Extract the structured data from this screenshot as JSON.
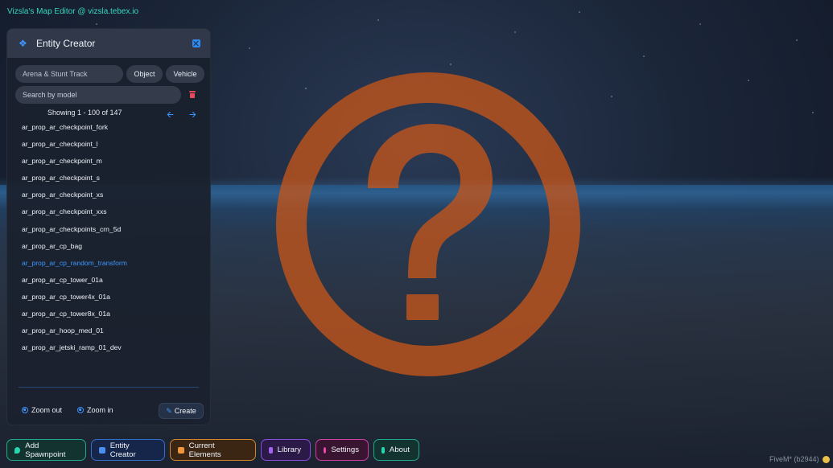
{
  "app": {
    "title": "Vizsla's Map Editor @ vizsla.tebex.io",
    "accent": "#3d96ff"
  },
  "panel": {
    "title": "Entity Creator",
    "header_icon": "dropbox-icon",
    "category_select": {
      "value": "Arena & Stunt Track"
    },
    "type_chips": [
      "Object",
      "Vehicle"
    ],
    "search": {
      "placeholder": "Search by model"
    },
    "paging": {
      "text": "Showing 1 - 100 of 147"
    },
    "items": [
      "ar_prop_ar_checkpoint_fork",
      "ar_prop_ar_checkpoint_l",
      "ar_prop_ar_checkpoint_m",
      "ar_prop_ar_checkpoint_s",
      "ar_prop_ar_checkpoint_xs",
      "ar_prop_ar_checkpoint_xxs",
      "ar_prop_ar_checkpoints_crn_5d",
      "ar_prop_ar_cp_bag",
      "ar_prop_ar_cp_random_transform",
      "ar_prop_ar_cp_tower_01a",
      "ar_prop_ar_cp_tower4x_01a",
      "ar_prop_ar_cp_tower8x_01a",
      "ar_prop_ar_hoop_med_01",
      "ar_prop_ar_jetski_ramp_01_dev"
    ],
    "selected_item": "ar_prop_ar_cp_random_transform",
    "zoom_out_label": "Zoom out",
    "zoom_in_label": "Zoom in",
    "create_label": "Create"
  },
  "nav": [
    {
      "label": "Add Spawnpoint",
      "icon": "pin-icon",
      "color": "#1ea88f"
    },
    {
      "label": "Entity Creator",
      "icon": "dropbox-icon",
      "color": "#3270c8"
    },
    {
      "label": "Current Elements",
      "icon": "box-icon",
      "color": "#d0842c"
    },
    {
      "label": "Library",
      "icon": "library-icon",
      "color": "#8a4bdd"
    },
    {
      "label": "Settings",
      "icon": "settings-icon",
      "color": "#cf3ea2"
    },
    {
      "label": "About",
      "icon": "book-icon",
      "color": "#1ea88f"
    }
  ],
  "status": {
    "fivem": "FiveM* (b2944)"
  },
  "preview": {
    "icon": "question-circle-icon",
    "color": "#c4551a"
  }
}
